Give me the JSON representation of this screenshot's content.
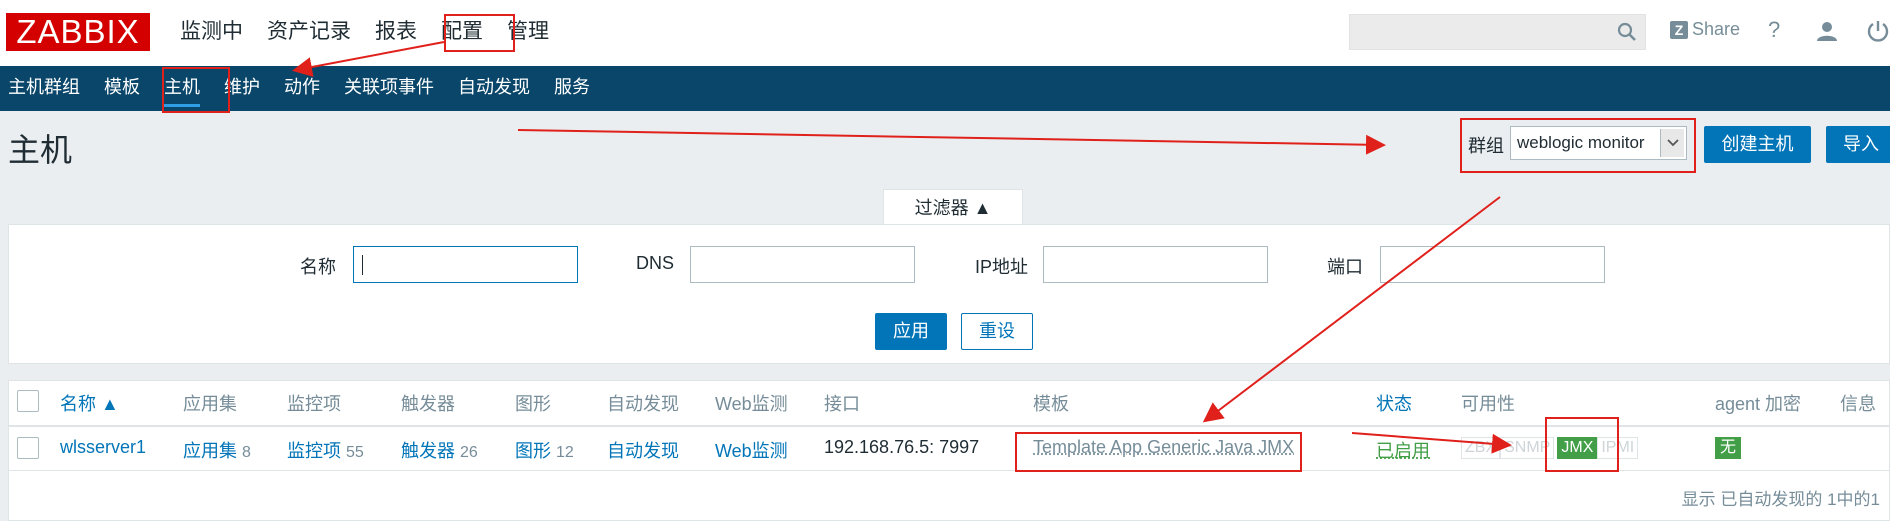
{
  "topbar": {
    "logo": "ZABBIX",
    "nav": [
      "监测中",
      "资产记录",
      "报表",
      "配置",
      "管理"
    ],
    "active_nav": "配置",
    "share_label": "Share",
    "help_label": "?"
  },
  "subnav": {
    "items": [
      "主机群组",
      "模板",
      "主机",
      "维护",
      "动作",
      "关联项事件",
      "自动发现",
      "服务"
    ],
    "active": "主机"
  },
  "header": {
    "title": "主机",
    "group_label": "群组",
    "group_value": "weblogic monitor",
    "create_button": "创建主机",
    "import_button": "导入"
  },
  "filter": {
    "tab_label": "过滤器 ▲",
    "name_label": "名称",
    "dns_label": "DNS",
    "ip_label": "IP地址",
    "port_label": "端口",
    "apply_button": "应用",
    "reset_button": "重设"
  },
  "table": {
    "headers": [
      "名称 ▲",
      "应用集",
      "监控项",
      "触发器",
      "图形",
      "自动发现",
      "Web监测",
      "接口",
      "模板",
      "状态",
      "可用性",
      "agent 加密",
      "信息"
    ],
    "rows": [
      {
        "name": "wlsserver1",
        "apps_label": "应用集",
        "apps_count": "8",
        "items_label": "监控项",
        "items_count": "55",
        "triggers_label": "触发器",
        "triggers_count": "26",
        "graphs_label": "图形",
        "graphs_count": "12",
        "discovery": "自动发现",
        "web": "Web监测",
        "interface": "192.168.76.5: 7997",
        "template": "Template App Generic Java JMX",
        "status": "已启用",
        "availability": [
          "ZBX",
          "SNMP",
          "JMX",
          "IPMI"
        ],
        "encryption": "无"
      }
    ],
    "footer": "显示 已自动发现的 1中的1"
  },
  "colors": {
    "logo_red": "#d40000",
    "subnav_bg": "#0a466a",
    "primary": "#0275b8",
    "green": "#429e47",
    "annotation": "#e0201b"
  }
}
